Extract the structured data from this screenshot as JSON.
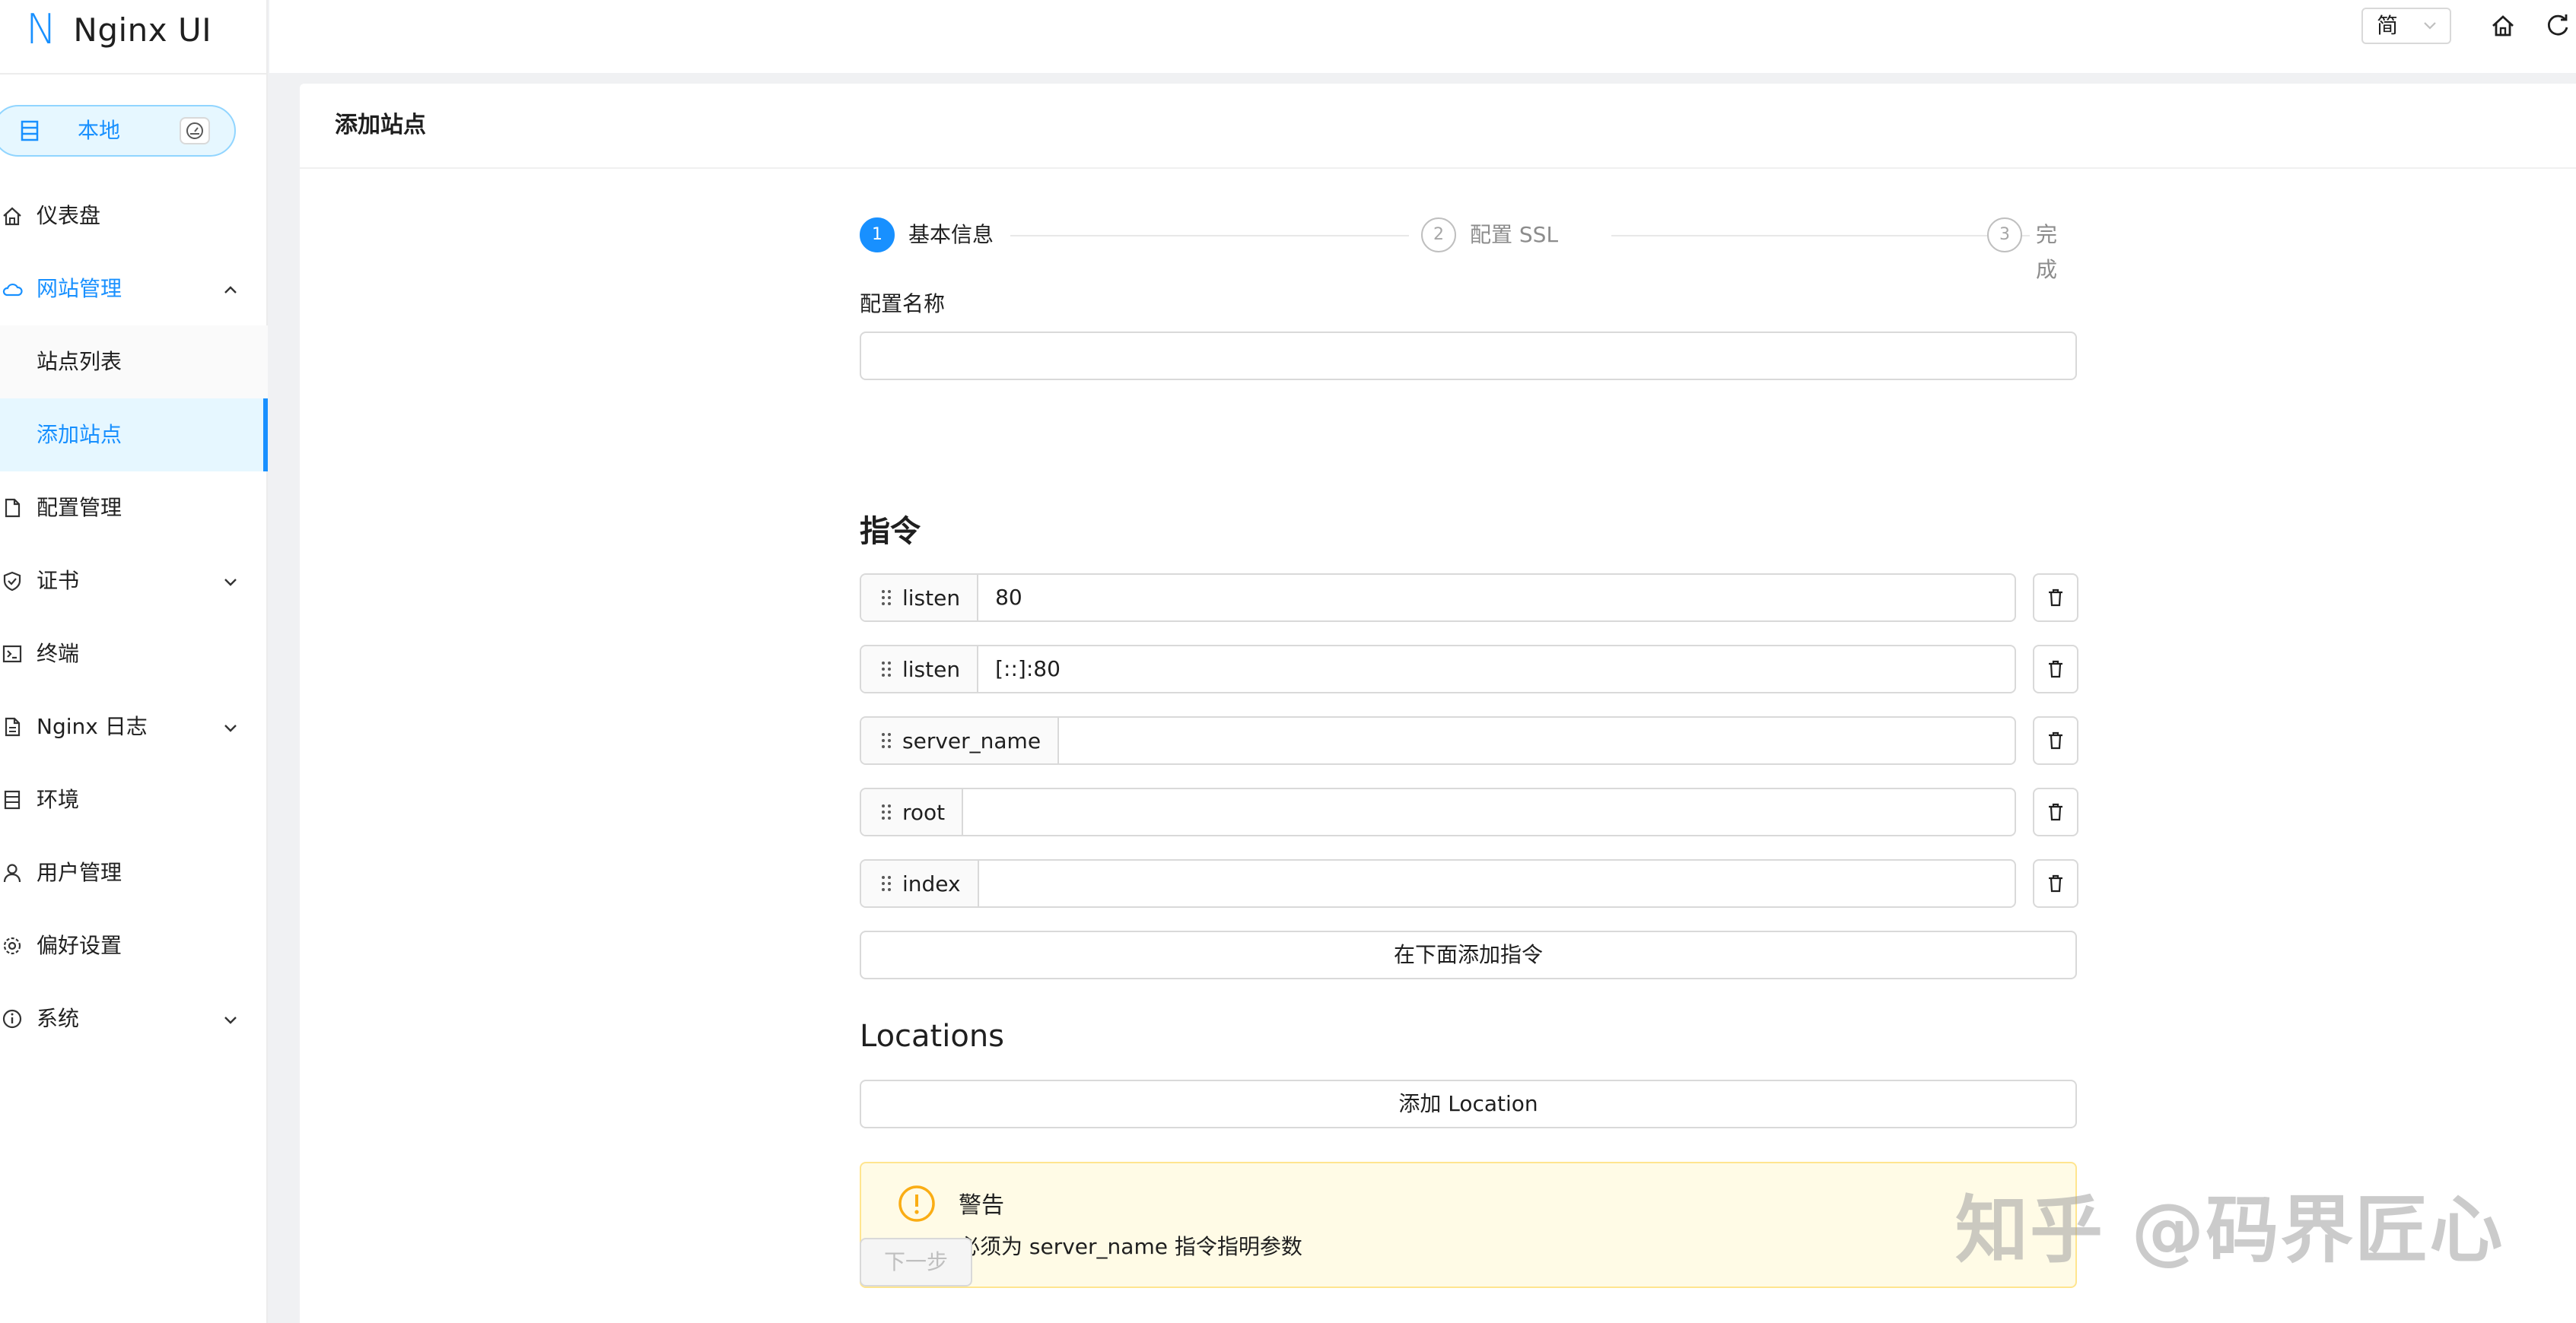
{
  "app": {
    "logo_mark": "N",
    "logo_text": "Nginx UI"
  },
  "node_switch": {
    "label": "本地"
  },
  "sidebar": {
    "items": [
      {
        "label": "仪表盘",
        "icon": "home-icon"
      },
      {
        "label": "网站管理",
        "icon": "cloud-icon",
        "expanded": true,
        "children": [
          {
            "label": "站点列表"
          },
          {
            "label": "添加站点",
            "active": true
          }
        ]
      },
      {
        "label": "配置管理",
        "icon": "file-icon"
      },
      {
        "label": "证书",
        "icon": "shield-icon"
      },
      {
        "label": "终端",
        "icon": "terminal-icon"
      },
      {
        "label": "Nginx 日志",
        "icon": "log-file-icon"
      },
      {
        "label": "环境",
        "icon": "database-icon"
      },
      {
        "label": "用户管理",
        "icon": "user-icon"
      },
      {
        "label": "偏好设置",
        "icon": "gear-icon"
      },
      {
        "label": "系统",
        "icon": "info-icon"
      }
    ]
  },
  "header": {
    "language": "简"
  },
  "page": {
    "title": "添加站点"
  },
  "steps": [
    {
      "number": "1",
      "label": "基本信息",
      "status": "active"
    },
    {
      "number": "2",
      "label": "配置 SSL",
      "status": "wait"
    },
    {
      "number": "3",
      "label": "完成",
      "status": "wait"
    }
  ],
  "form": {
    "config_name_label": "配置名称",
    "config_name_value": "",
    "directives_title": "指令",
    "directives": [
      {
        "name": "listen",
        "value": "80"
      },
      {
        "name": "listen",
        "value": "[::]:80"
      },
      {
        "name": "server_name",
        "value": ""
      },
      {
        "name": "root",
        "value": ""
      },
      {
        "name": "index",
        "value": ""
      }
    ],
    "add_directive_label": "在下面添加指令",
    "locations_title": "Locations",
    "add_location_label": "添加 Location"
  },
  "alert": {
    "title": "警告",
    "message": "必须为 server_name 指令指明参数",
    "color": "#faad14"
  },
  "next_button": {
    "label": "下一步"
  },
  "watermark": "知乎 @码界匠心",
  "colors": {
    "primary": "#1890ff",
    "warning_bg": "#fffbe6",
    "warning_border": "#ffe58f"
  }
}
